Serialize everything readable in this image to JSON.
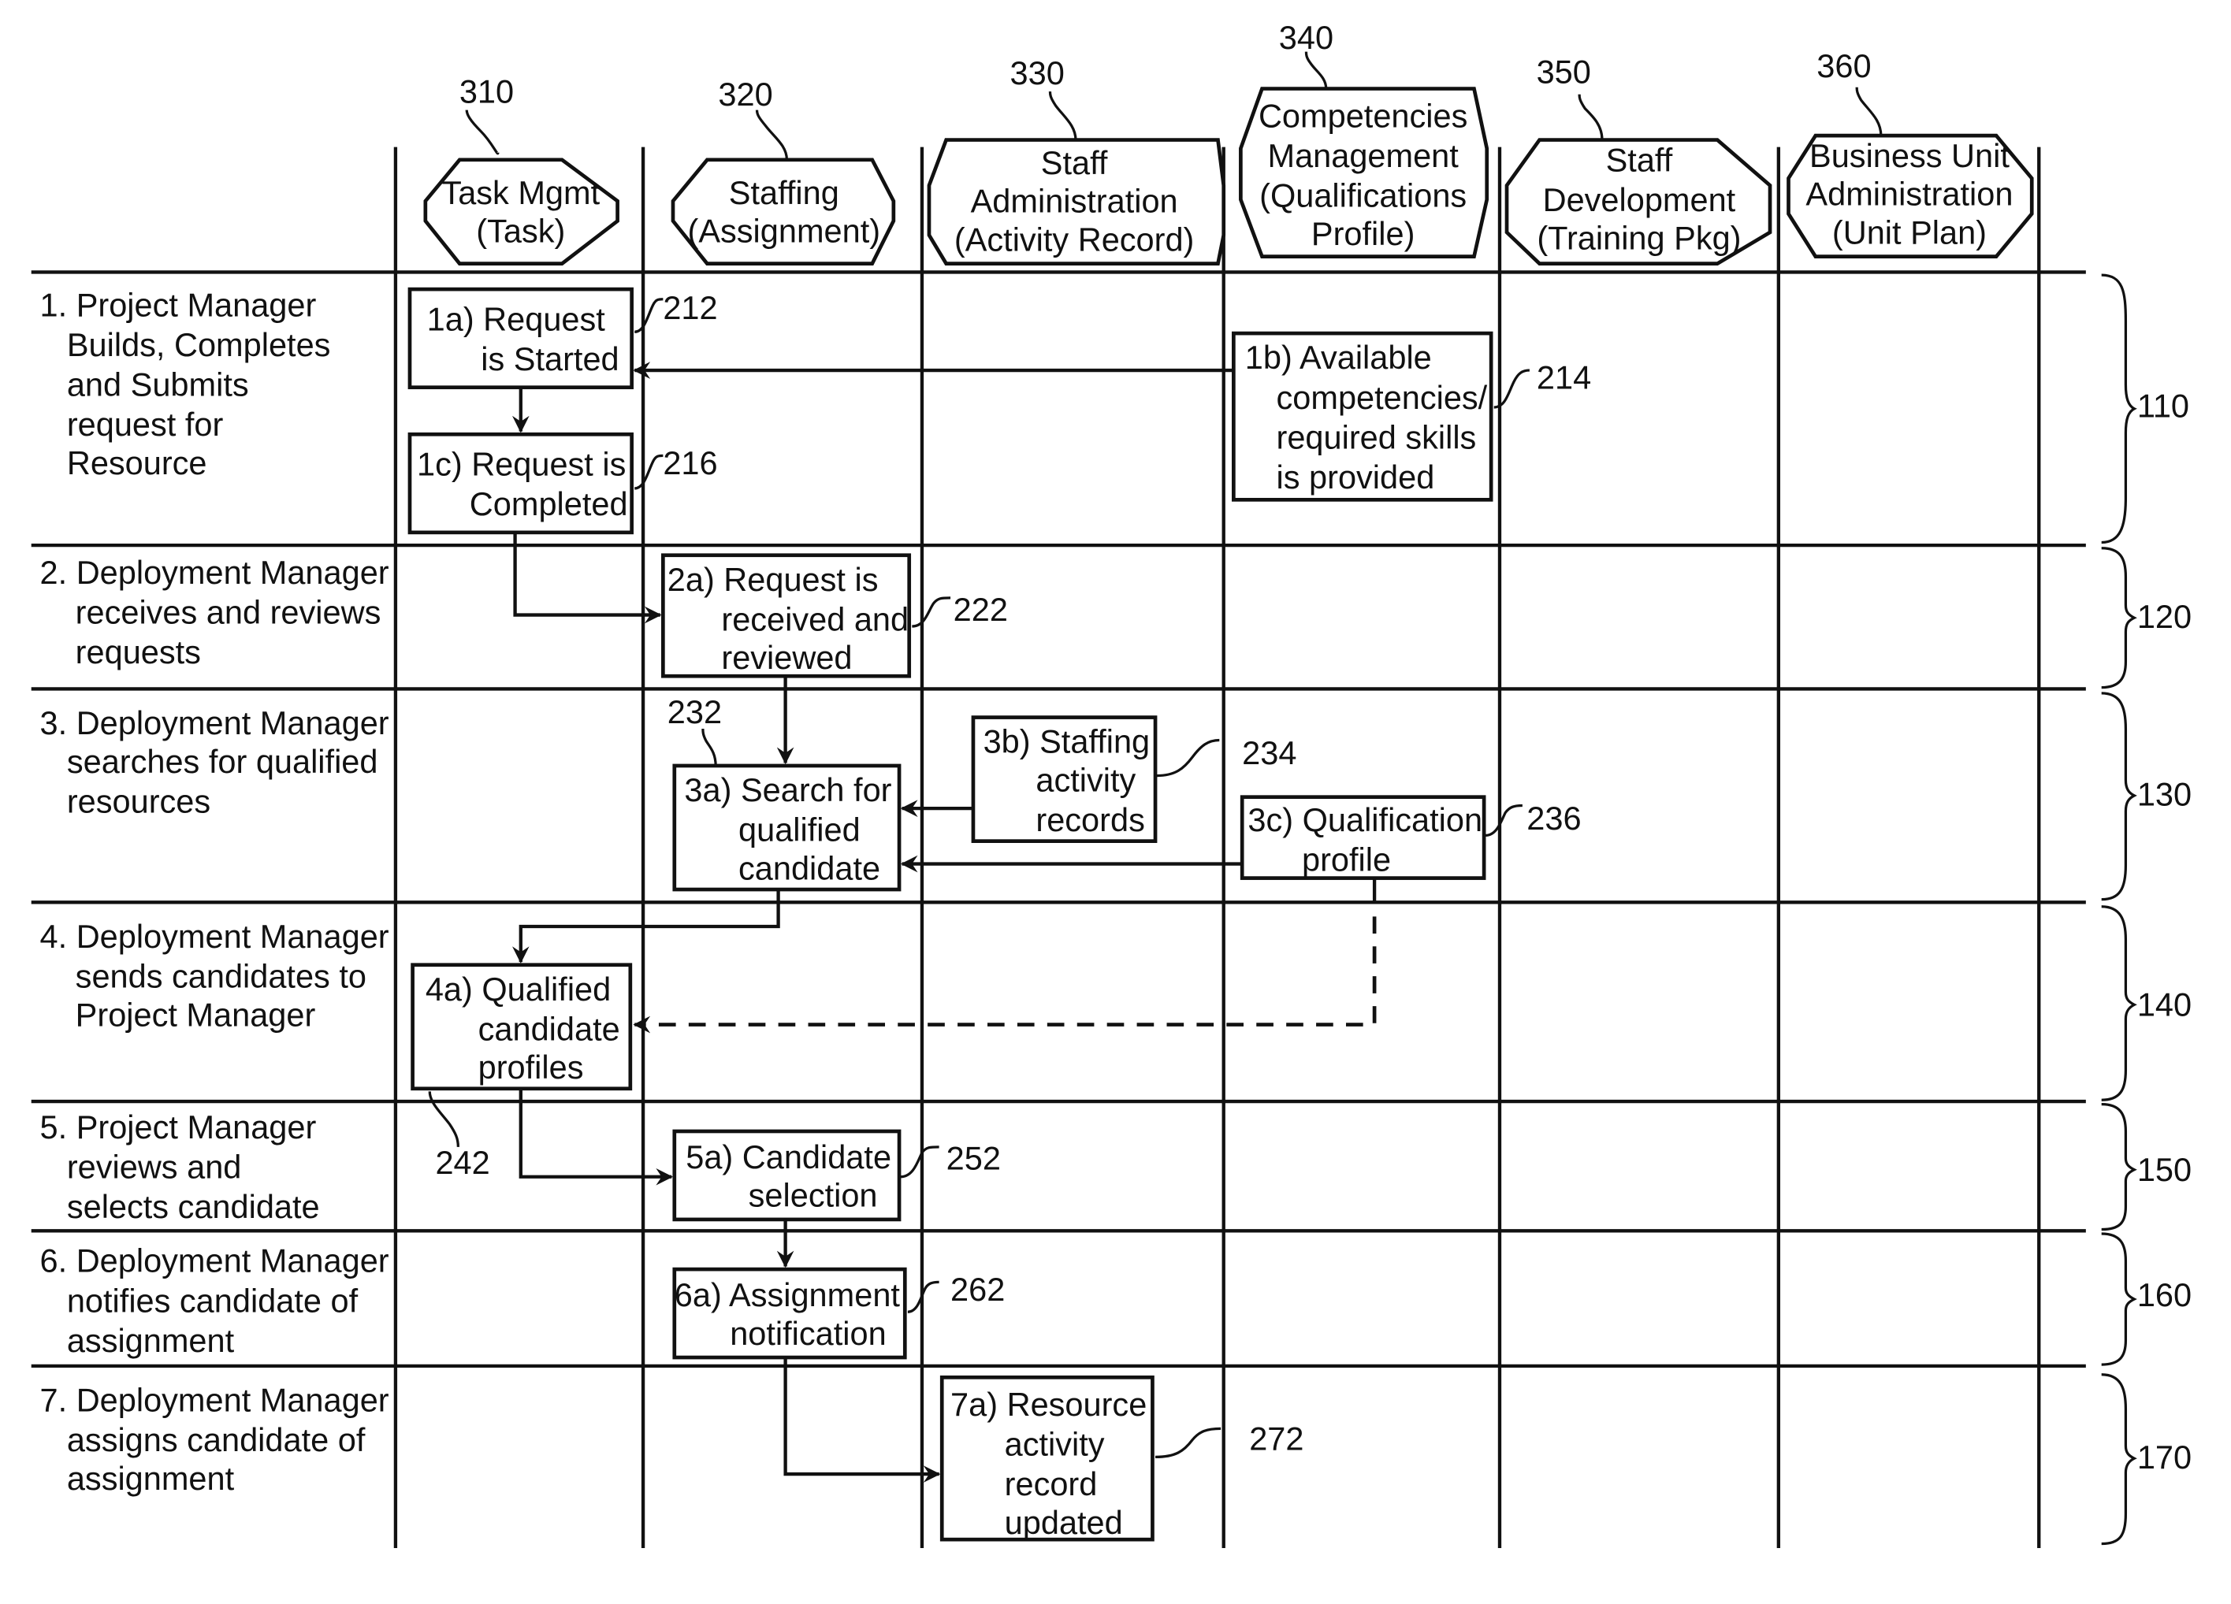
{
  "swimlanes": [
    {
      "ref": "310",
      "lines": [
        "Task Mgmt",
        "(Task)"
      ]
    },
    {
      "ref": "320",
      "lines": [
        "Staffing",
        "(Assignment)"
      ]
    },
    {
      "ref": "330",
      "lines": [
        "Staff",
        "Administration",
        "(Activity Record)"
      ]
    },
    {
      "ref": "340",
      "lines": [
        "Competencies",
        "Management",
        "(Qualifications",
        "Profile)"
      ]
    },
    {
      "ref": "350",
      "lines": [
        "Staff",
        "Development",
        "(Training Pkg)"
      ]
    },
    {
      "ref": "360",
      "lines": [
        "Business Unit",
        "Administration",
        "(Unit Plan)"
      ]
    }
  ],
  "phases": [
    {
      "ref": "110",
      "lines": [
        "1. Project Manager",
        "Builds, Completes",
        "and Submits",
        "request for",
        "Resource"
      ]
    },
    {
      "ref": "120",
      "lines": [
        "2. Deployment Manager",
        "receives and reviews",
        "requests"
      ]
    },
    {
      "ref": "130",
      "lines": [
        "3. Deployment Manager",
        "searches for qualified",
        "resources"
      ]
    },
    {
      "ref": "140",
      "lines": [
        "4. Deployment Manager",
        "sends candidates to",
        "Project Manager"
      ]
    },
    {
      "ref": "150",
      "lines": [
        "5. Project Manager",
        "reviews and",
        "selects candidate"
      ]
    },
    {
      "ref": "160",
      "lines": [
        "6. Deployment Manager",
        "notifies candidate of",
        "assignment"
      ]
    },
    {
      "ref": "170",
      "lines": [
        "7. Deployment Manager",
        "assigns candidate of",
        "assignment"
      ]
    }
  ],
  "steps": [
    {
      "id": "1a",
      "ref": "212",
      "lines": [
        "1a) Request",
        "is Started"
      ]
    },
    {
      "id": "1b",
      "ref": "214",
      "lines": [
        "1b) Available",
        "competencies/",
        "required skills",
        "is provided"
      ]
    },
    {
      "id": "1c",
      "ref": "216",
      "lines": [
        "1c) Request is",
        "Completed"
      ]
    },
    {
      "id": "2a",
      "ref": "222",
      "lines": [
        "2a) Request is",
        "received and",
        "reviewed"
      ]
    },
    {
      "id": "3a",
      "ref": "232",
      "lines": [
        "3a) Search for",
        "qualified",
        "candidate"
      ]
    },
    {
      "id": "3b",
      "ref": "234",
      "lines": [
        "3b) Staffing",
        "activity",
        "records"
      ]
    },
    {
      "id": "3c",
      "ref": "236",
      "lines": [
        "3c) Qualification",
        "profile"
      ]
    },
    {
      "id": "4a",
      "ref": "242",
      "lines": [
        "4a) Qualified",
        "candidate",
        "profiles"
      ]
    },
    {
      "id": "5a",
      "ref": "252",
      "lines": [
        "5a) Candidate",
        "selection"
      ]
    },
    {
      "id": "6a",
      "ref": "262",
      "lines": [
        "6a) Assignment",
        "notification"
      ]
    },
    {
      "id": "7a",
      "ref": "272",
      "lines": [
        "7a) Resource",
        "activity",
        "record",
        "updated"
      ]
    }
  ]
}
